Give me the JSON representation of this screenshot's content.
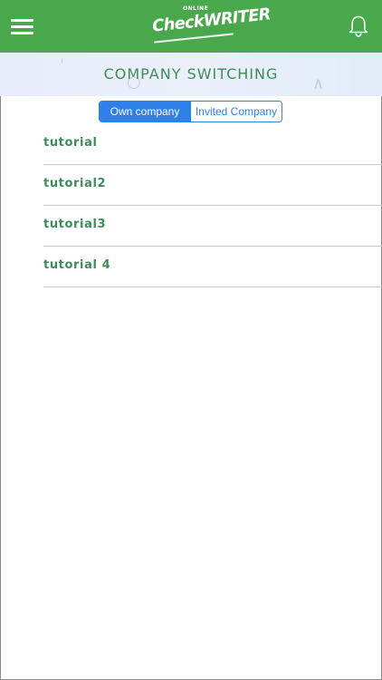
{
  "header": {
    "logo_top": "ONLINE",
    "logo_main": "CheckWRITER",
    "menu_icon": "hamburger-menu-icon",
    "notification_icon": "bell-icon",
    "color": "#4aa84c"
  },
  "banner": {
    "title": "COMPANY SWITCHING"
  },
  "tabs": {
    "own_label": "Own company",
    "invited_label": "Invited Company",
    "active": "own",
    "accent": "#2f7fe9"
  },
  "companies": [
    {
      "name": "tutorial"
    },
    {
      "name": "tutorial2"
    },
    {
      "name": "tutorial3"
    },
    {
      "name": "tutorial 4"
    }
  ]
}
